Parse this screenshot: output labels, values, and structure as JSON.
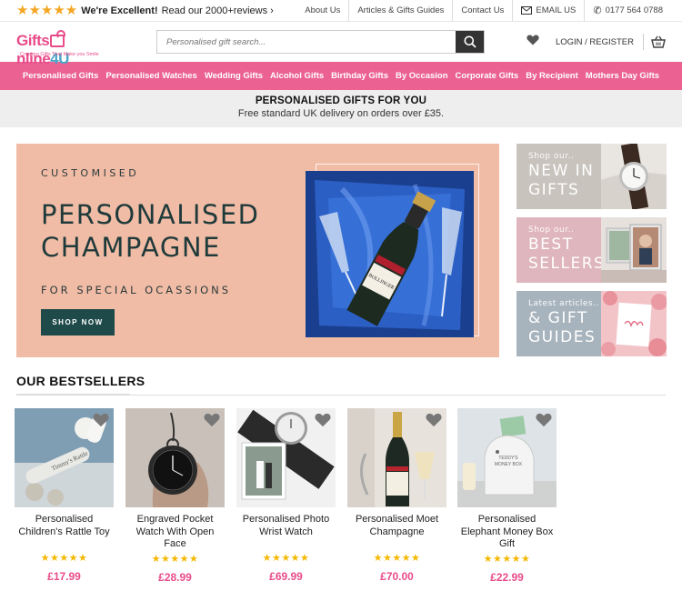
{
  "topbar": {
    "rating_stars": "★★★★★",
    "review_strong": "We're Excellent!",
    "review_link": "Read our 2000+reviews ›",
    "links": [
      {
        "label": "About Us"
      },
      {
        "label": "Articles & Gifts Guides"
      },
      {
        "label": "Contact Us"
      },
      {
        "label": "EMAIL US",
        "icon": "envelope-icon"
      },
      {
        "label": "0177 564 0788",
        "icon": "phone-icon"
      }
    ]
  },
  "header": {
    "logo_text_a": "Gifts",
    "logo_text_b": "nline",
    "logo_text_c": "4U",
    "logo_tagline": "Creating Gifts That Make you Smile",
    "search_placeholder": "Personalised gift search...",
    "login_label": "LOGIN / REGISTER"
  },
  "nav": {
    "items": [
      "Personalised Gifts",
      "Personalised Watches",
      "Wedding Gifts",
      "Alcohol Gifts",
      "Birthday Gifts",
      "By Occasion",
      "Corporate Gifts",
      "By Recipient",
      "Mothers Day Gifts"
    ]
  },
  "promo": {
    "title": "PERSONALISED GIFTS FOR YOU",
    "subtitle": "Free standard UK delivery on orders over £35."
  },
  "hero": {
    "kicker": "CUSTOMISED",
    "title_line1": "PERSONALISED",
    "title_line2": "CHAMPAGNE",
    "subtitle": "FOR SPECIAL OCASSIONS",
    "button": "SHOP NOW",
    "bottle_label": "BOLLINGER",
    "bg_color": "#f1bca6"
  },
  "side_tiles": [
    {
      "small": "Shop our..",
      "big1": "NEW IN",
      "big2": "GIFTS",
      "color": "#c8c3bc"
    },
    {
      "small": "Shop our..",
      "big1": "BEST",
      "big2": "SELLERS",
      "color": "#dfb6bd"
    },
    {
      "small": "Latest articles..",
      "big1": "& GIFT",
      "big2": "GUIDES",
      "color": "#a7b4be"
    }
  ],
  "bestsellers": {
    "heading": "OUR BESTSELLERS",
    "products": [
      {
        "name": "Personalised Children's Rattle Toy",
        "price": "£17.99",
        "stars": "★★★★★"
      },
      {
        "name": "Engraved Pocket Watch With Open Face",
        "price": "£28.99",
        "stars": "★★★★★"
      },
      {
        "name": "Personalised Photo Wrist Watch",
        "price": "£69.99",
        "stars": "★★★★★"
      },
      {
        "name": "Personalised Moet Champagne",
        "price": "£70.00",
        "stars": "★★★★★"
      },
      {
        "name": "Personalised Elephant Money Box Gift",
        "price": "£22.99",
        "stars": "★★★★★"
      }
    ]
  },
  "colors": {
    "brand_pink": "#ea6192",
    "price_pink": "#e84c8a",
    "star_gold": "#f5b800",
    "hero_button": "#1f4a4a"
  }
}
